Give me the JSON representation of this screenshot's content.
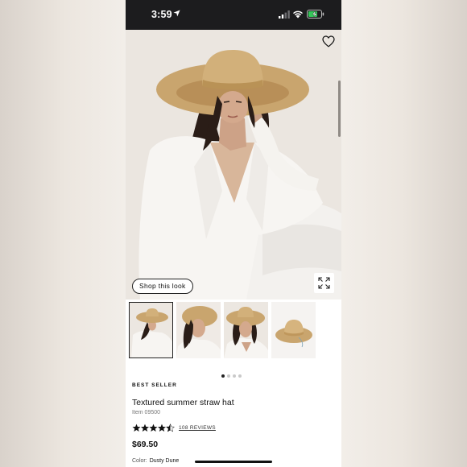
{
  "status_bar": {
    "time": "3:59"
  },
  "product_view": {
    "shop_look_label": "Shop this look",
    "gallery_pages": 4,
    "active_page": 1
  },
  "product": {
    "badge": "BEST SELLER",
    "name": "Textured summer straw hat",
    "item_number": "Item 09500",
    "rating": 4.5,
    "reviews_label": "108 REVIEWS",
    "price": "$69.50",
    "color_label": "Color:",
    "color_value": "Dusty Dune"
  },
  "icons": [
    "location-arrow-icon",
    "cellular-signal-icon",
    "wifi-icon",
    "battery-charging-icon",
    "heart-icon",
    "expand-icon",
    "star-icon"
  ],
  "colors": {
    "hat": "#c9a56e",
    "shirt": "#f7f5f2",
    "status_bar": "#1c1c1e",
    "battery": "#34c759"
  }
}
